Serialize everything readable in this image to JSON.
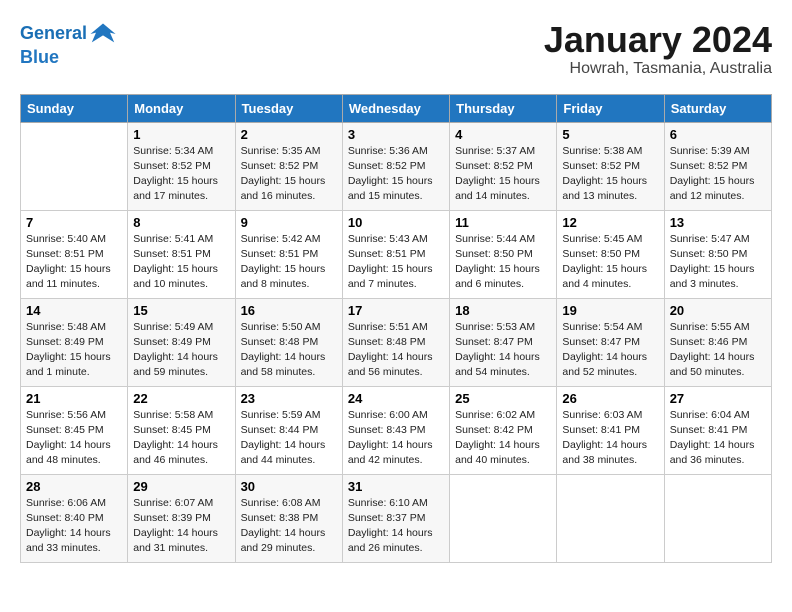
{
  "header": {
    "logo_line1": "General",
    "logo_line2": "Blue",
    "month": "January 2024",
    "location": "Howrah, Tasmania, Australia"
  },
  "days_of_week": [
    "Sunday",
    "Monday",
    "Tuesday",
    "Wednesday",
    "Thursday",
    "Friday",
    "Saturday"
  ],
  "weeks": [
    [
      {
        "day": "",
        "sunrise": "",
        "sunset": "",
        "daylight": ""
      },
      {
        "day": "1",
        "sunrise": "Sunrise: 5:34 AM",
        "sunset": "Sunset: 8:52 PM",
        "daylight": "Daylight: 15 hours and 17 minutes."
      },
      {
        "day": "2",
        "sunrise": "Sunrise: 5:35 AM",
        "sunset": "Sunset: 8:52 PM",
        "daylight": "Daylight: 15 hours and 16 minutes."
      },
      {
        "day": "3",
        "sunrise": "Sunrise: 5:36 AM",
        "sunset": "Sunset: 8:52 PM",
        "daylight": "Daylight: 15 hours and 15 minutes."
      },
      {
        "day": "4",
        "sunrise": "Sunrise: 5:37 AM",
        "sunset": "Sunset: 8:52 PM",
        "daylight": "Daylight: 15 hours and 14 minutes."
      },
      {
        "day": "5",
        "sunrise": "Sunrise: 5:38 AM",
        "sunset": "Sunset: 8:52 PM",
        "daylight": "Daylight: 15 hours and 13 minutes."
      },
      {
        "day": "6",
        "sunrise": "Sunrise: 5:39 AM",
        "sunset": "Sunset: 8:52 PM",
        "daylight": "Daylight: 15 hours and 12 minutes."
      }
    ],
    [
      {
        "day": "7",
        "sunrise": "Sunrise: 5:40 AM",
        "sunset": "Sunset: 8:51 PM",
        "daylight": "Daylight: 15 hours and 11 minutes."
      },
      {
        "day": "8",
        "sunrise": "Sunrise: 5:41 AM",
        "sunset": "Sunset: 8:51 PM",
        "daylight": "Daylight: 15 hours and 10 minutes."
      },
      {
        "day": "9",
        "sunrise": "Sunrise: 5:42 AM",
        "sunset": "Sunset: 8:51 PM",
        "daylight": "Daylight: 15 hours and 8 minutes."
      },
      {
        "day": "10",
        "sunrise": "Sunrise: 5:43 AM",
        "sunset": "Sunset: 8:51 PM",
        "daylight": "Daylight: 15 hours and 7 minutes."
      },
      {
        "day": "11",
        "sunrise": "Sunrise: 5:44 AM",
        "sunset": "Sunset: 8:50 PM",
        "daylight": "Daylight: 15 hours and 6 minutes."
      },
      {
        "day": "12",
        "sunrise": "Sunrise: 5:45 AM",
        "sunset": "Sunset: 8:50 PM",
        "daylight": "Daylight: 15 hours and 4 minutes."
      },
      {
        "day": "13",
        "sunrise": "Sunrise: 5:47 AM",
        "sunset": "Sunset: 8:50 PM",
        "daylight": "Daylight: 15 hours and 3 minutes."
      }
    ],
    [
      {
        "day": "14",
        "sunrise": "Sunrise: 5:48 AM",
        "sunset": "Sunset: 8:49 PM",
        "daylight": "Daylight: 15 hours and 1 minute."
      },
      {
        "day": "15",
        "sunrise": "Sunrise: 5:49 AM",
        "sunset": "Sunset: 8:49 PM",
        "daylight": "Daylight: 14 hours and 59 minutes."
      },
      {
        "day": "16",
        "sunrise": "Sunrise: 5:50 AM",
        "sunset": "Sunset: 8:48 PM",
        "daylight": "Daylight: 14 hours and 58 minutes."
      },
      {
        "day": "17",
        "sunrise": "Sunrise: 5:51 AM",
        "sunset": "Sunset: 8:48 PM",
        "daylight": "Daylight: 14 hours and 56 minutes."
      },
      {
        "day": "18",
        "sunrise": "Sunrise: 5:53 AM",
        "sunset": "Sunset: 8:47 PM",
        "daylight": "Daylight: 14 hours and 54 minutes."
      },
      {
        "day": "19",
        "sunrise": "Sunrise: 5:54 AM",
        "sunset": "Sunset: 8:47 PM",
        "daylight": "Daylight: 14 hours and 52 minutes."
      },
      {
        "day": "20",
        "sunrise": "Sunrise: 5:55 AM",
        "sunset": "Sunset: 8:46 PM",
        "daylight": "Daylight: 14 hours and 50 minutes."
      }
    ],
    [
      {
        "day": "21",
        "sunrise": "Sunrise: 5:56 AM",
        "sunset": "Sunset: 8:45 PM",
        "daylight": "Daylight: 14 hours and 48 minutes."
      },
      {
        "day": "22",
        "sunrise": "Sunrise: 5:58 AM",
        "sunset": "Sunset: 8:45 PM",
        "daylight": "Daylight: 14 hours and 46 minutes."
      },
      {
        "day": "23",
        "sunrise": "Sunrise: 5:59 AM",
        "sunset": "Sunset: 8:44 PM",
        "daylight": "Daylight: 14 hours and 44 minutes."
      },
      {
        "day": "24",
        "sunrise": "Sunrise: 6:00 AM",
        "sunset": "Sunset: 8:43 PM",
        "daylight": "Daylight: 14 hours and 42 minutes."
      },
      {
        "day": "25",
        "sunrise": "Sunrise: 6:02 AM",
        "sunset": "Sunset: 8:42 PM",
        "daylight": "Daylight: 14 hours and 40 minutes."
      },
      {
        "day": "26",
        "sunrise": "Sunrise: 6:03 AM",
        "sunset": "Sunset: 8:41 PM",
        "daylight": "Daylight: 14 hours and 38 minutes."
      },
      {
        "day": "27",
        "sunrise": "Sunrise: 6:04 AM",
        "sunset": "Sunset: 8:41 PM",
        "daylight": "Daylight: 14 hours and 36 minutes."
      }
    ],
    [
      {
        "day": "28",
        "sunrise": "Sunrise: 6:06 AM",
        "sunset": "Sunset: 8:40 PM",
        "daylight": "Daylight: 14 hours and 33 minutes."
      },
      {
        "day": "29",
        "sunrise": "Sunrise: 6:07 AM",
        "sunset": "Sunset: 8:39 PM",
        "daylight": "Daylight: 14 hours and 31 minutes."
      },
      {
        "day": "30",
        "sunrise": "Sunrise: 6:08 AM",
        "sunset": "Sunset: 8:38 PM",
        "daylight": "Daylight: 14 hours and 29 minutes."
      },
      {
        "day": "31",
        "sunrise": "Sunrise: 6:10 AM",
        "sunset": "Sunset: 8:37 PM",
        "daylight": "Daylight: 14 hours and 26 minutes."
      },
      {
        "day": "",
        "sunrise": "",
        "sunset": "",
        "daylight": ""
      },
      {
        "day": "",
        "sunrise": "",
        "sunset": "",
        "daylight": ""
      },
      {
        "day": "",
        "sunrise": "",
        "sunset": "",
        "daylight": ""
      }
    ]
  ]
}
